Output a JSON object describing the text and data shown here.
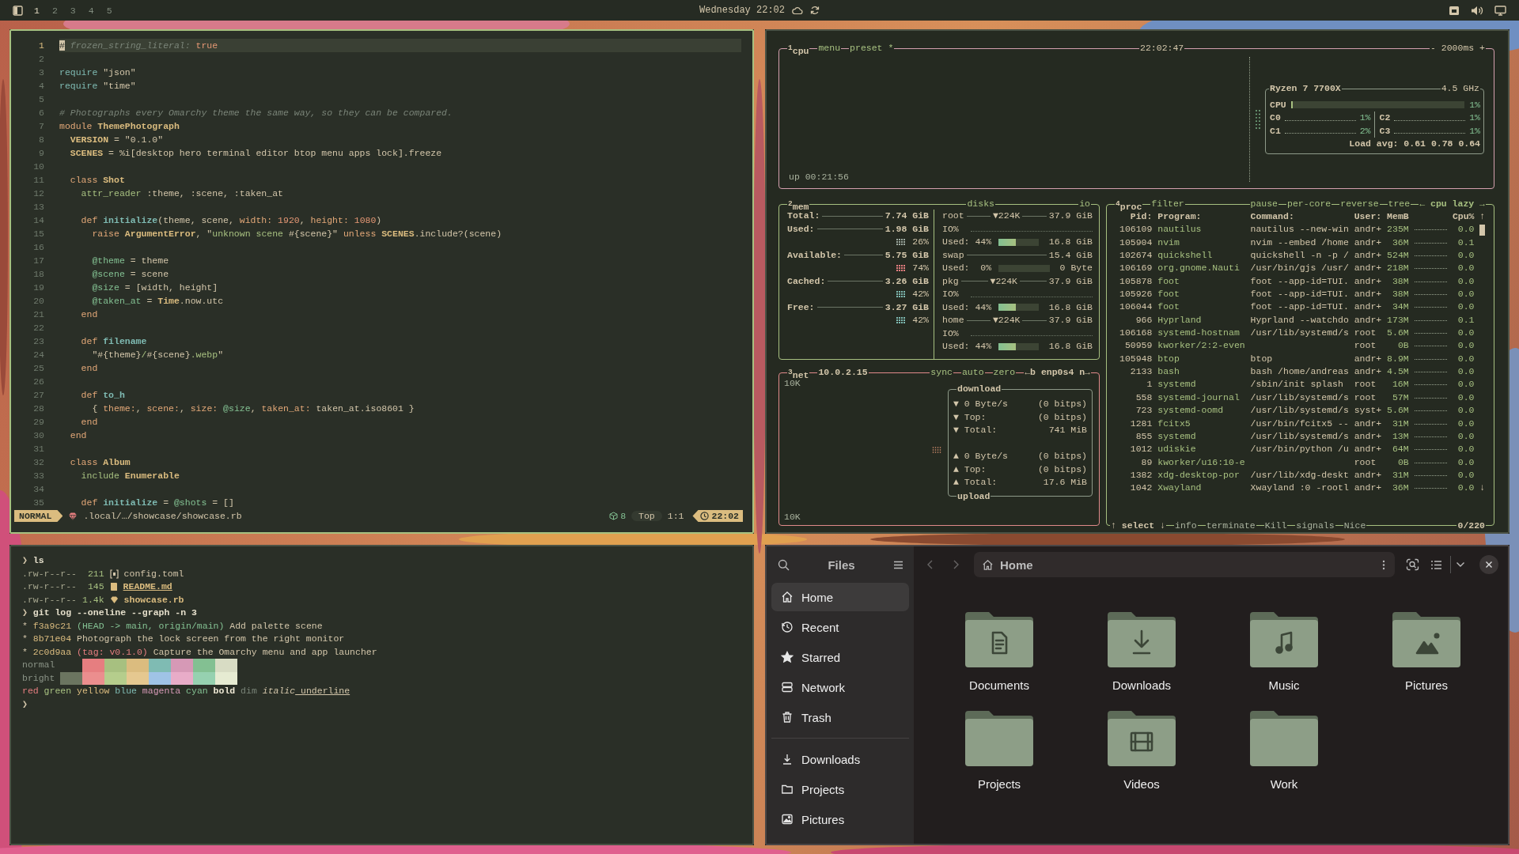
{
  "top_bar": {
    "workspaces": [
      {
        "label": "1",
        "selected": true
      },
      {
        "label": "2",
        "selected": false
      },
      {
        "label": "3",
        "selected": false
      },
      {
        "label": "4",
        "selected": false
      },
      {
        "label": "5",
        "selected": false
      }
    ],
    "clock": "Wednesday 22:02"
  },
  "editor": {
    "lines": [
      {
        "number": "1",
        "current": true,
        "tokens": [
          {
            "text": "#",
            "kind": "cursor"
          },
          {
            "text": " frozen_string_literal: ",
            "kind": "com"
          },
          {
            "text": "true",
            "kind": "num"
          }
        ]
      },
      {
        "number": "2",
        "current": false
      },
      {
        "number": "3",
        "current": false,
        "tokens": [
          {
            "text": "require",
            "kind": "req"
          },
          {
            "text": " \"json\""
          }
        ]
      },
      {
        "number": "4",
        "current": false,
        "tokens": [
          {
            "text": "require",
            "kind": "req"
          },
          {
            "text": " \"time\""
          }
        ]
      },
      {
        "number": "5",
        "current": false
      },
      {
        "number": "6",
        "current": false,
        "tokens": [
          {
            "text": "# Photographs every Omarchy theme the same way, so they can be compared.",
            "kind": "com"
          }
        ]
      },
      {
        "number": "7",
        "current": false,
        "tokens": [
          {
            "text": "module",
            "kind": "kw"
          },
          {
            "text": " ThemePhotograph",
            "kind": "type"
          }
        ]
      },
      {
        "number": "8",
        "current": false,
        "tokens": [
          {
            "text": "  VERSION",
            "kind": "type"
          },
          {
            "text": " = \"0.1.0\""
          }
        ]
      },
      {
        "number": "9",
        "current": false,
        "tokens": [
          {
            "text": "  SCENES",
            "kind": "type"
          },
          {
            "text": " = %i[desktop hero terminal editor btop menu apps lock].freeze"
          }
        ]
      },
      {
        "number": "10",
        "current": false
      },
      {
        "number": "11",
        "current": false,
        "tokens": [
          {
            "text": "  class",
            "kind": "kw"
          },
          {
            "text": " Shot",
            "kind": "type"
          }
        ]
      },
      {
        "number": "12",
        "current": false,
        "tokens": [
          {
            "text": "    attr_reader",
            "kind": "str"
          },
          {
            "text": " :theme, :scene, :taken_at"
          }
        ]
      },
      {
        "number": "13",
        "current": false
      },
      {
        "number": "14",
        "current": false,
        "tokens": [
          {
            "text": "    def",
            "kind": "kw"
          },
          {
            "text": " initialize",
            "kind": "fn"
          },
          {
            "text": "(theme, scene, "
          },
          {
            "text": "width:",
            "kind": "kw"
          },
          {
            "text": " 1920",
            "kind": "num"
          },
          {
            "text": ", "
          },
          {
            "text": "height:",
            "kind": "kw"
          },
          {
            "text": " 1080",
            "kind": "num"
          },
          {
            "text": ")"
          }
        ]
      },
      {
        "number": "15",
        "current": false,
        "tokens": [
          {
            "text": "      raise",
            "kind": "kw"
          },
          {
            "text": " ArgumentError",
            "kind": "type"
          },
          {
            "text": ", \""
          },
          {
            "text": "unknown scene",
            "kind": "str"
          },
          {
            "text": " #{scene}\""
          },
          {
            "text": " unless",
            "kind": "kw"
          },
          {
            "text": " SCENES",
            "kind": "type"
          },
          {
            "text": ".include?(scene)"
          }
        ]
      },
      {
        "number": "16",
        "current": false
      },
      {
        "number": "17",
        "current": false,
        "tokens": [
          {
            "text": "      @theme",
            "kind": "ivar"
          },
          {
            "text": " = theme"
          }
        ]
      },
      {
        "number": "18",
        "current": false,
        "tokens": [
          {
            "text": "      @scene",
            "kind": "ivar"
          },
          {
            "text": " = scene"
          }
        ]
      },
      {
        "number": "19",
        "current": false,
        "tokens": [
          {
            "text": "      @size",
            "kind": "ivar"
          },
          {
            "text": " = [width, height]"
          }
        ]
      },
      {
        "number": "20",
        "current": false,
        "tokens": [
          {
            "text": "      @taken_at",
            "kind": "ivar"
          },
          {
            "text": " = "
          },
          {
            "text": "Time",
            "kind": "type"
          },
          {
            "text": ".now.utc"
          }
        ]
      },
      {
        "number": "21",
        "current": false,
        "tokens": [
          {
            "text": "    end",
            "kind": "kw"
          }
        ]
      },
      {
        "number": "22",
        "current": false
      },
      {
        "number": "23",
        "current": false,
        "tokens": [
          {
            "text": "    def",
            "kind": "kw"
          },
          {
            "text": " filename",
            "kind": "fn"
          }
        ]
      },
      {
        "number": "24",
        "current": false,
        "tokens": [
          {
            "text": "      \"#{theme}"
          },
          {
            "text": "/",
            "kind": "str"
          },
          {
            "text": "#{scene}"
          },
          {
            "text": ".webp",
            "kind": "str"
          },
          {
            "text": "\""
          }
        ]
      },
      {
        "number": "25",
        "current": false,
        "tokens": [
          {
            "text": "    end",
            "kind": "kw"
          }
        ]
      },
      {
        "number": "26",
        "current": false
      },
      {
        "number": "27",
        "current": false,
        "tokens": [
          {
            "text": "    def",
            "kind": "kw"
          },
          {
            "text": " to_h",
            "kind": "fn"
          }
        ]
      },
      {
        "number": "28",
        "current": false,
        "tokens": [
          {
            "text": "      { "
          },
          {
            "text": "theme:",
            "kind": "kw"
          },
          {
            "text": ", "
          },
          {
            "text": "scene:",
            "kind": "kw"
          },
          {
            "text": ", "
          },
          {
            "text": "size:",
            "kind": "kw"
          },
          {
            "text": " @size",
            "kind": "ivar"
          },
          {
            "text": ", "
          },
          {
            "text": "taken_at:",
            "kind": "kw"
          },
          {
            "text": " taken_at.iso8601 }"
          }
        ]
      },
      {
        "number": "29",
        "current": false,
        "tokens": [
          {
            "text": "    end",
            "kind": "kw"
          }
        ]
      },
      {
        "number": "30",
        "current": false,
        "tokens": [
          {
            "text": "  end",
            "kind": "kw"
          }
        ]
      },
      {
        "number": "31",
        "current": false
      },
      {
        "number": "32",
        "current": false,
        "tokens": [
          {
            "text": "  class",
            "kind": "kw"
          },
          {
            "text": " Album",
            "kind": "type"
          }
        ]
      },
      {
        "number": "33",
        "current": false,
        "tokens": [
          {
            "text": "    include",
            "kind": "str"
          },
          {
            "text": " Enumerable",
            "kind": "type"
          }
        ]
      },
      {
        "number": "34",
        "current": false
      },
      {
        "number": "35",
        "current": false,
        "tokens": [
          {
            "text": "    def",
            "kind": "kw"
          },
          {
            "text": " initialize",
            "kind": "fn"
          },
          {
            "text": " = "
          },
          {
            "text": "@shots",
            "kind": "ivar"
          },
          {
            "text": " = []"
          }
        ]
      }
    ],
    "status": {
      "mode": "NORMAL",
      "path": ".local/…/showcase/showcase.rb",
      "diagnostics": "8",
      "scroll": "Top",
      "position": "1:1",
      "clock": "22:02"
    }
  },
  "btop": {
    "cpu": {
      "title": "$^{1}$cpu",
      "options": [
        "menu",
        "preset *"
      ],
      "time": "22:02:47",
      "interval": "- 2000ms +",
      "uptime": "up 00:21:56",
      "model": "Ryzen 7 7700X",
      "clock_speed": "4.5 GHz",
      "total": {
        "label": "CPU",
        "level": 0.01,
        "value": "1%"
      },
      "cores": [
        {
          "label": "C0",
          "value": "1%"
        },
        {
          "label": "C2",
          "value": "1%"
        },
        {
          "label": "C1",
          "value": "2%"
        },
        {
          "label": "C3",
          "value": "1%"
        }
      ],
      "load": "Load avg: 0.61 0.78 0.64"
    },
    "mem": {
      "title": "$^{2}$mem",
      "rows": [
        {
          "label": "Total:",
          "value": "7.74 GiB"
        },
        {
          "label": "Used:",
          "value": "1.98 GiB",
          "percent": "26%",
          "color": "#9da9a0"
        },
        {
          "label": "Available:",
          "value": "5.75 GiB",
          "percent": "74%",
          "color": "#e67e80"
        },
        {
          "label": "Cached:",
          "value": "3.26 GiB",
          "percent": "42%",
          "color": "#7fbbb3"
        },
        {
          "label": "Free:",
          "value": "3.27 GiB",
          "percent": "42%",
          "color": "#7fbbb3"
        }
      ]
    },
    "disks": {
      "title": "disks",
      "io": "io",
      "items": [
        {
          "name": "root",
          "io_rate": "▼224K",
          "size": "37.9 GiB",
          "io_label": "IO%",
          "used": "Used: 44%",
          "level": 0.44,
          "used_size": "16.8 GiB"
        },
        {
          "name": "swap",
          "size": "15.4 GiB",
          "used": "Used:  0%",
          "level": 0,
          "used_size": "0 Byte"
        },
        {
          "name": "pkg",
          "io_rate": "▼224K",
          "size": "37.9 GiB",
          "io_label": "IO%",
          "used": "Used: 44%",
          "level": 0.44,
          "used_size": "16.8 GiB"
        },
        {
          "name": "home",
          "io_rate": "▼224K",
          "size": "37.9 GiB",
          "io_label": "IO%",
          "used": "Used: 44%",
          "level": 0.44,
          "used_size": "16.8 GiB"
        }
      ]
    },
    "net": {
      "title": "$^{3}$net",
      "address": "10.0.2.15",
      "options": [
        "sync",
        "auto",
        "zero"
      ],
      "interface": "←b enp0s4 n→",
      "scale_top": "10K",
      "scale_bottom": "10K",
      "download": {
        "title": "download",
        "rows": [
          {
            "label": "▼ 0 Byte/s",
            "value": "(0 bitps)"
          },
          {
            "label": "▼ Top:",
            "value": "(0 bitps)"
          },
          {
            "label": "▼ Total:",
            "value": "741 MiB"
          }
        ]
      },
      "upload": {
        "title": "upload",
        "rows": [
          {
            "label": "▲ 0 Byte/s",
            "value": "(0 bitps)"
          },
          {
            "label": "▲ Top:",
            "value": "(0 bitps)"
          },
          {
            "label": "▲ Total:",
            "value": "17.6 MiB"
          }
        ]
      }
    },
    "proc": {
      "title": "$^{4}$proc",
      "filter": "filter",
      "options": [
        "pause",
        "per-core",
        "reverse",
        "tree",
        "← cpu lazy →"
      ],
      "columns": [
        "Pid:",
        "Program:",
        "Command:",
        "User:",
        "MemB",
        "Cpu%"
      ],
      "scroll_up": "↑",
      "scroll_down": "↓",
      "rows": [
        {
          "pid": "106109",
          "program": "nautilus",
          "command": "nautilus --new-win",
          "user": "andr+",
          "mem": "235M",
          "cpu": "0.0"
        },
        {
          "pid": "105904",
          "program": "nvim",
          "command": "nvim --embed /home",
          "user": "andr+",
          "mem": "36M",
          "cpu": "0.1"
        },
        {
          "pid": "102674",
          "program": "quickshell",
          "command": "quickshell -n -p /",
          "user": "andr+",
          "mem": "524M",
          "cpu": "0.0"
        },
        {
          "pid": "106169",
          "program": "org.gnome.Nauti",
          "command": "/usr/bin/gjs /usr/",
          "user": "andr+",
          "mem": "218M",
          "cpu": "0.0"
        },
        {
          "pid": "105878",
          "program": "foot",
          "command": "foot --app-id=TUI.",
          "user": "andr+",
          "mem": "38M",
          "cpu": "0.0"
        },
        {
          "pid": "105926",
          "program": "foot",
          "command": "foot --app-id=TUI.",
          "user": "andr+",
          "mem": "38M",
          "cpu": "0.0"
        },
        {
          "pid": "106044",
          "program": "foot",
          "command": "foot --app-id=TUI.",
          "user": "andr+",
          "mem": "34M",
          "cpu": "0.0"
        },
        {
          "pid": "966",
          "program": "Hyprland",
          "command": "Hyprland --watchdo",
          "user": "andr+",
          "mem": "173M",
          "cpu": "0.1"
        },
        {
          "pid": "106168",
          "program": "systemd-hostnam",
          "command": "/usr/lib/systemd/s",
          "user": "root",
          "mem": "5.6M",
          "cpu": "0.0"
        },
        {
          "pid": "50959",
          "program": "kworker/2:2-even",
          "user": "root",
          "mem": "0B",
          "cpu": "0.0"
        },
        {
          "pid": "105948",
          "program": "btop",
          "command": "btop",
          "user": "andr+",
          "mem": "8.9M",
          "cpu": "0.0"
        },
        {
          "pid": "2133",
          "program": "bash",
          "command": "bash /home/andreas",
          "user": "andr+",
          "mem": "4.5M",
          "cpu": "0.0"
        },
        {
          "pid": "1",
          "program": "systemd",
          "command": "/sbin/init splash",
          "user": "root",
          "mem": "16M",
          "cpu": "0.0"
        },
        {
          "pid": "558",
          "program": "systemd-journal",
          "command": "/usr/lib/systemd/s",
          "user": "root",
          "mem": "57M",
          "cpu": "0.0"
        },
        {
          "pid": "723",
          "program": "systemd-oomd",
          "command": "/usr/lib/systemd/s",
          "user": "syst+",
          "mem": "5.6M",
          "cpu": "0.0"
        },
        {
          "pid": "1281",
          "program": "fcitx5",
          "command": "/usr/bin/fcitx5 --",
          "user": "andr+",
          "mem": "31M",
          "cpu": "0.0"
        },
        {
          "pid": "855",
          "program": "systemd",
          "command": "/usr/lib/systemd/s",
          "user": "andr+",
          "mem": "13M",
          "cpu": "0.0"
        },
        {
          "pid": "1012",
          "program": "udiskie",
          "command": "/usr/bin/python /u",
          "user": "andr+",
          "mem": "64M",
          "cpu": "0.0"
        },
        {
          "pid": "89",
          "program": "kworker/u16:10-e",
          "user": "root",
          "mem": "0B",
          "cpu": "0.0"
        },
        {
          "pid": "1382",
          "program": "xdg-desktop-por",
          "command": "/usr/lib/xdg-deskt",
          "user": "andr+",
          "mem": "31M",
          "cpu": "0.0"
        },
        {
          "pid": "1042",
          "program": "Xwayland",
          "command": "Xwayland :0 -rootl",
          "user": "andr+",
          "mem": "36M",
          "cpu": "0.0"
        }
      ],
      "footer": [
        "↑ select ↓",
        "info",
        "terminate",
        "Kill",
        "signals",
        "Nice"
      ],
      "count": "0/220"
    }
  },
  "terminal": {
    "lines": [
      {
        "kind": "text",
        "tokens": [
          {
            "text": "❯",
            "kind": "prompt"
          },
          {
            "text": " ls",
            "kind": "cmd"
          }
        ]
      },
      {
        "kind": "ls",
        "perms": ".rw-r--r--",
        "size": "211",
        "file": {
          "kind": "toml",
          "name": "config.toml"
        }
      },
      {
        "kind": "ls",
        "perms": ".rw-r--r--",
        "size": "145",
        "file": {
          "kind": "markdown",
          "name": "README.md"
        }
      },
      {
        "kind": "ls",
        "perms": ".rw-r--r--",
        "size": "1.4k",
        "file": {
          "kind": "ruby",
          "name": "showcase.rb"
        }
      },
      {
        "kind": "text",
        "tokens": [
          {
            "text": "❯",
            "kind": "prompt"
          },
          {
            "text": " git log --oneline --graph -n 3",
            "kind": "cmd"
          }
        ]
      },
      {
        "kind": "text",
        "tokens": [
          {
            "text": "* "
          },
          {
            "text": "f3a9c21",
            "kind": "hash"
          },
          {
            "text": " (HEAD -> main, origin/main)",
            "kind": "ref"
          },
          {
            "text": " Add palette scene"
          }
        ]
      },
      {
        "kind": "text",
        "tokens": [
          {
            "text": "* "
          },
          {
            "text": "8b71e04",
            "kind": "hash"
          },
          {
            "text": " Photograph the lock screen from the right monitor"
          }
        ]
      },
      {
        "kind": "text",
        "tokens": [
          {
            "text": "* "
          },
          {
            "text": "2c0d9aa",
            "kind": "hash"
          },
          {
            "text": " (tag: v0.1.0)",
            "kind": "tag"
          },
          {
            "text": " Capture the Omarchy menu and app launcher"
          }
        ]
      },
      {
        "kind": "palette",
        "label": "normal",
        "swatches": [
          {
            "color": "#e67e80"
          },
          {
            "color": "#a7c080"
          },
          {
            "color": "#dbbc7f"
          },
          {
            "color": "#7fbbb3"
          },
          {
            "color": "#d699b6"
          },
          {
            "color": "#83c092"
          },
          {
            "color": "#d8dcc4"
          }
        ]
      },
      {
        "kind": "palette",
        "label": "bright",
        "swatches": [
          {
            "color": "#6b7560"
          },
          {
            "color": "#eb8e8e"
          },
          {
            "color": "#b5cd8c"
          },
          {
            "color": "#e5c890"
          },
          {
            "color": "#9fc3e6"
          },
          {
            "color": "#e8acc8"
          },
          {
            "color": "#96d1b0"
          },
          {
            "color": "#e6ebd2"
          }
        ]
      },
      {
        "kind": "text",
        "tokens": [
          {
            "text": "red",
            "kind": "red"
          },
          {
            "text": " green",
            "kind": "green"
          },
          {
            "text": " yellow",
            "kind": "yellow"
          },
          {
            "text": " blue",
            "kind": "blue"
          },
          {
            "text": " magenta",
            "kind": "magenta"
          },
          {
            "text": " cyan",
            "kind": "cyan"
          },
          {
            "text": " bold",
            "kind": "bold"
          },
          {
            "text": " dim",
            "kind": "dim"
          },
          {
            "text": " italic",
            "kind": "italic"
          },
          {
            "text": " underline",
            "kind": "underline"
          }
        ]
      },
      {
        "kind": "text",
        "tokens": [
          {
            "text": "❯",
            "kind": "prompt"
          }
        ]
      }
    ]
  },
  "files": {
    "title": "Files",
    "back_disabled": true,
    "forward_disabled": true,
    "path": "Home",
    "places": [
      {
        "label": "Home",
        "kind": "home",
        "selected": true
      },
      {
        "label": "Recent",
        "kind": "recent",
        "selected": false
      },
      {
        "label": "Starred",
        "kind": "starred",
        "selected": false
      },
      {
        "label": "Network",
        "kind": "network",
        "selected": false
      },
      {
        "label": "Trash",
        "kind": "trash",
        "selected": false
      }
    ],
    "bookmarks": [
      {
        "label": "Downloads",
        "kind": "downloads",
        "selected": false
      },
      {
        "label": "Projects",
        "kind": "folder",
        "selected": false
      },
      {
        "label": "Pictures",
        "kind": "pictures",
        "selected": false
      }
    ],
    "folders": [
      {
        "label": "Documents",
        "kind": "documents"
      },
      {
        "label": "Downloads",
        "kind": "downloads"
      },
      {
        "label": "Music",
        "kind": "music"
      },
      {
        "label": "Pictures",
        "kind": "pictures"
      },
      {
        "label": "Projects",
        "kind": "plain"
      },
      {
        "label": "Videos",
        "kind": "videos"
      },
      {
        "label": "Work",
        "kind": "plain"
      }
    ]
  }
}
